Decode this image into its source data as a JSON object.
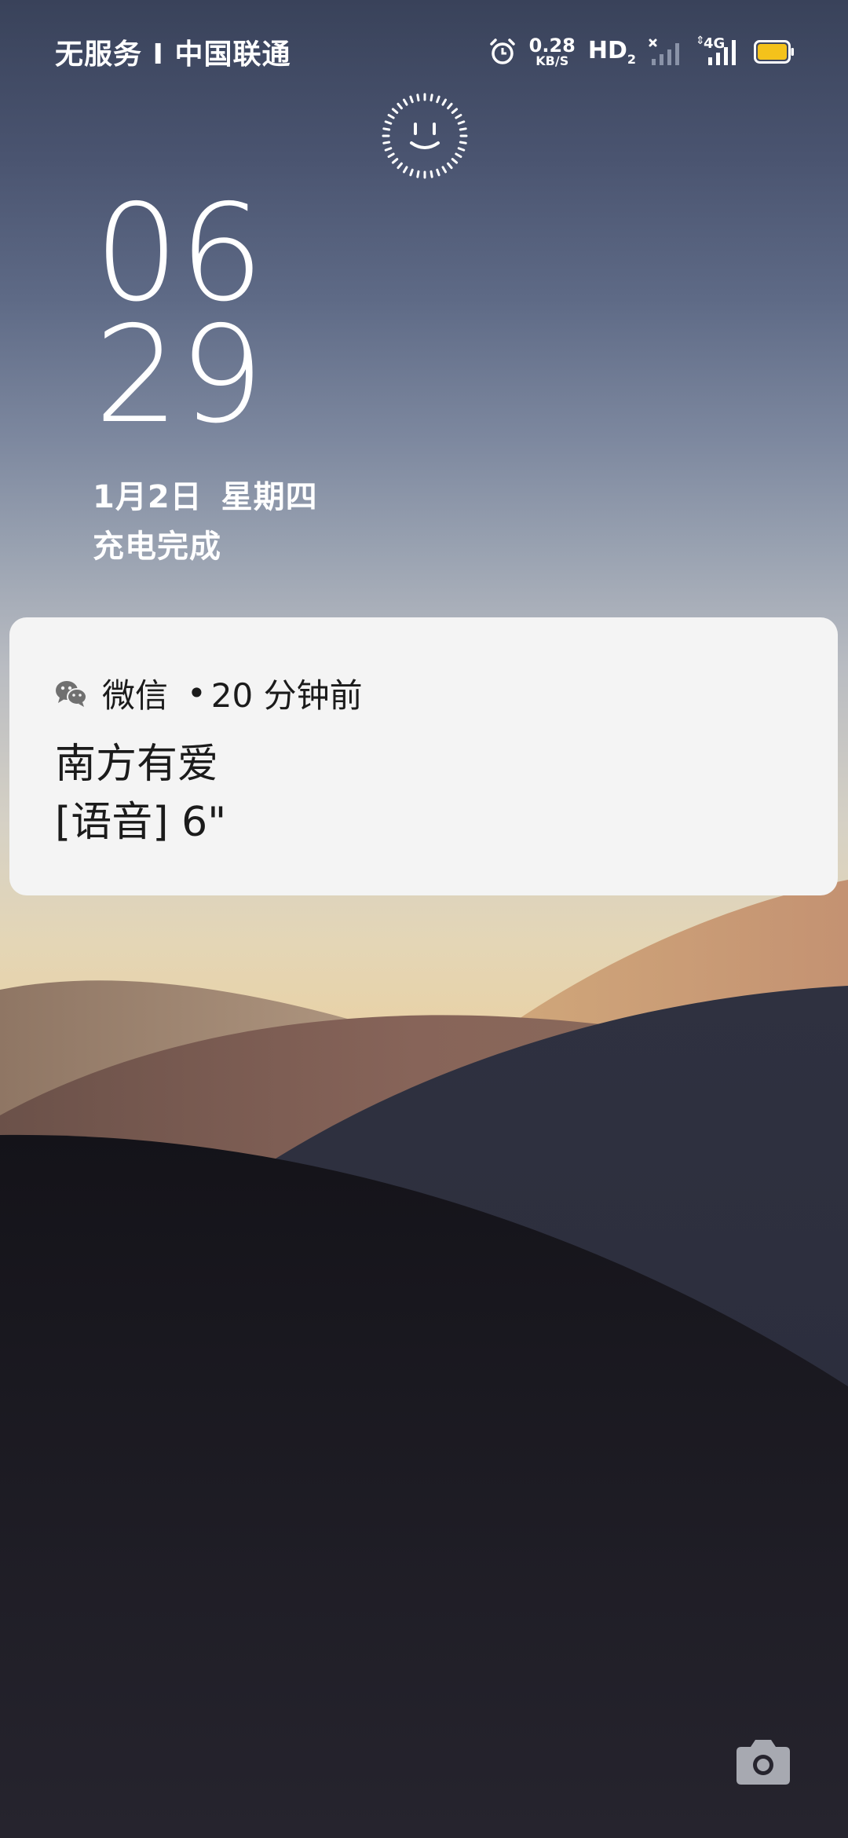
{
  "status_bar": {
    "carrier": "无服务 I 中国联通",
    "net_speed_value": "0.28",
    "net_speed_unit": "KB/S",
    "hd_label": "HD",
    "hd_index": "2",
    "network_type": "4G",
    "icons": [
      "alarm-icon",
      "hd-icon",
      "signal-sim1-no-service-icon",
      "signal-4g-icon",
      "battery-icon"
    ],
    "battery_color": "#f4c21b"
  },
  "lock_screen": {
    "face_unlock_icon": "face-unlock-icon",
    "time_hour": "06",
    "time_minute": "29",
    "date": "1月2日",
    "weekday": "星期四",
    "charge_status": "充电完成"
  },
  "notification": {
    "app_icon": "wechat-icon",
    "app_name": "微信",
    "separator": "•",
    "time_ago": "20 分钟前",
    "sender": "南方有爱",
    "message": "[语音] 6\""
  },
  "shortcuts": {
    "camera_icon": "camera-icon"
  }
}
